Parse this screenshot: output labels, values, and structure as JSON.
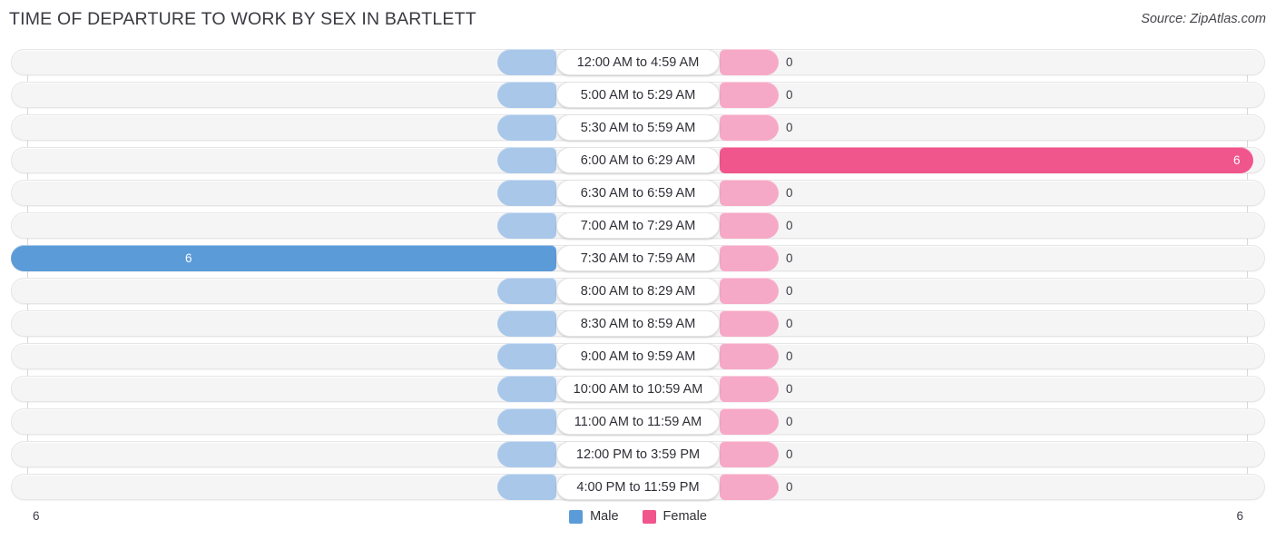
{
  "header": {
    "title": "TIME OF DEPARTURE TO WORK BY SEX IN BARTLETT",
    "source": "Source: ZipAtlas.com"
  },
  "legend": {
    "male_label": "Male",
    "female_label": "Female",
    "male_color": "#5b9bd8",
    "female_color": "#f0558c",
    "male_stub_color": "#a9c7e9",
    "female_stub_color": "#f6a9c6"
  },
  "axis": {
    "left_tick": "6",
    "right_tick": "6",
    "max": 6
  },
  "chart_data": {
    "type": "bar",
    "orientation": "horizontal-diverging",
    "title": "TIME OF DEPARTURE TO WORK BY SEX IN BARTLETT",
    "xlabel": "",
    "ylabel": "",
    "xlim": [
      6,
      0,
      6
    ],
    "grid": false,
    "legend_position": "bottom-center",
    "categories": [
      "12:00 AM to 4:59 AM",
      "5:00 AM to 5:29 AM",
      "5:30 AM to 5:59 AM",
      "6:00 AM to 6:29 AM",
      "6:30 AM to 6:59 AM",
      "7:00 AM to 7:29 AM",
      "7:30 AM to 7:59 AM",
      "8:00 AM to 8:29 AM",
      "8:30 AM to 8:59 AM",
      "9:00 AM to 9:59 AM",
      "10:00 AM to 10:59 AM",
      "11:00 AM to 11:59 AM",
      "12:00 PM to 3:59 PM",
      "4:00 PM to 11:59 PM"
    ],
    "series": [
      {
        "name": "Male",
        "values": [
          0,
          0,
          0,
          0,
          0,
          0,
          6,
          0,
          0,
          0,
          0,
          0,
          0,
          0
        ]
      },
      {
        "name": "Female",
        "values": [
          0,
          0,
          0,
          6,
          0,
          0,
          0,
          0,
          0,
          0,
          0,
          0,
          0,
          0
        ]
      }
    ]
  },
  "rows": [
    {
      "label": "12:00 AM to 4:59 AM",
      "male": "0",
      "female": "0",
      "male_filled": false,
      "female_filled": false
    },
    {
      "label": "5:00 AM to 5:29 AM",
      "male": "0",
      "female": "0",
      "male_filled": false,
      "female_filled": false
    },
    {
      "label": "5:30 AM to 5:59 AM",
      "male": "0",
      "female": "0",
      "male_filled": false,
      "female_filled": false
    },
    {
      "label": "6:00 AM to 6:29 AM",
      "male": "0",
      "female": "6",
      "male_filled": false,
      "female_filled": true
    },
    {
      "label": "6:30 AM to 6:59 AM",
      "male": "0",
      "female": "0",
      "male_filled": false,
      "female_filled": false
    },
    {
      "label": "7:00 AM to 7:29 AM",
      "male": "0",
      "female": "0",
      "male_filled": false,
      "female_filled": false
    },
    {
      "label": "7:30 AM to 7:59 AM",
      "male": "6",
      "female": "0",
      "male_filled": true,
      "female_filled": false
    },
    {
      "label": "8:00 AM to 8:29 AM",
      "male": "0",
      "female": "0",
      "male_filled": false,
      "female_filled": false
    },
    {
      "label": "8:30 AM to 8:59 AM",
      "male": "0",
      "female": "0",
      "male_filled": false,
      "female_filled": false
    },
    {
      "label": "9:00 AM to 9:59 AM",
      "male": "0",
      "female": "0",
      "male_filled": false,
      "female_filled": false
    },
    {
      "label": "10:00 AM to 10:59 AM",
      "male": "0",
      "female": "0",
      "male_filled": false,
      "female_filled": false
    },
    {
      "label": "11:00 AM to 11:59 AM",
      "male": "0",
      "female": "0",
      "male_filled": false,
      "female_filled": false
    },
    {
      "label": "12:00 PM to 3:59 PM",
      "male": "0",
      "female": "0",
      "male_filled": false,
      "female_filled": false
    },
    {
      "label": "4:00 PM to 11:59 PM",
      "male": "0",
      "female": "0",
      "male_filled": false,
      "female_filled": false
    }
  ]
}
